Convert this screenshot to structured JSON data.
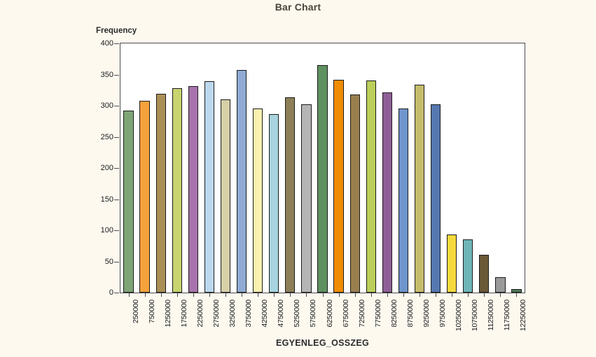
{
  "chart_data": {
    "type": "bar",
    "title": "Bar Chart",
    "xlabel": "EGYENLEG_OSSZEG",
    "ylabel": "Frequency",
    "ylim": [
      0,
      400
    ],
    "yticks": [
      0,
      50,
      100,
      150,
      200,
      250,
      300,
      350,
      400
    ],
    "grid": false,
    "legend": "none",
    "categories": [
      "250000",
      "750000",
      "1250000",
      "1750000",
      "2250000",
      "2750000",
      "3250000",
      "3750000",
      "4250000",
      "4750000",
      "5250000",
      "5750000",
      "6250000",
      "6750000",
      "7250000",
      "7750000",
      "8250000",
      "8750000",
      "9250000",
      "9750000",
      "10250000",
      "10750000",
      "11250000",
      "11750000",
      "12250000"
    ],
    "values": [
      292,
      308,
      319,
      328,
      332,
      339,
      310,
      357,
      296,
      287,
      313,
      302,
      365,
      342,
      318,
      341,
      321,
      296,
      334,
      302,
      93,
      85,
      61,
      25,
      6
    ],
    "bar_colors": [
      "#7fa577",
      "#f5a23c",
      "#ab9055",
      "#c8d46e",
      "#a873ad",
      "#bcd8ef",
      "#d6cfa7",
      "#8fabd4",
      "#faf0b0",
      "#a7d4de",
      "#8d7f58",
      "#b5b5b5",
      "#5f9160",
      "#f08c00",
      "#9a7f4e",
      "#bbcf5a",
      "#8e5f96",
      "#6e96cc",
      "#c5bd6c",
      "#5578b0",
      "#f5d93c",
      "#6fb5b8",
      "#6b5a36",
      "#9a9a9a",
      "#4e7a5a"
    ],
    "bar_border_color": "#1b1b1b",
    "plot_background": "#ffffff",
    "page_background": "#fdf9ef",
    "title_color": "#4a4438"
  }
}
